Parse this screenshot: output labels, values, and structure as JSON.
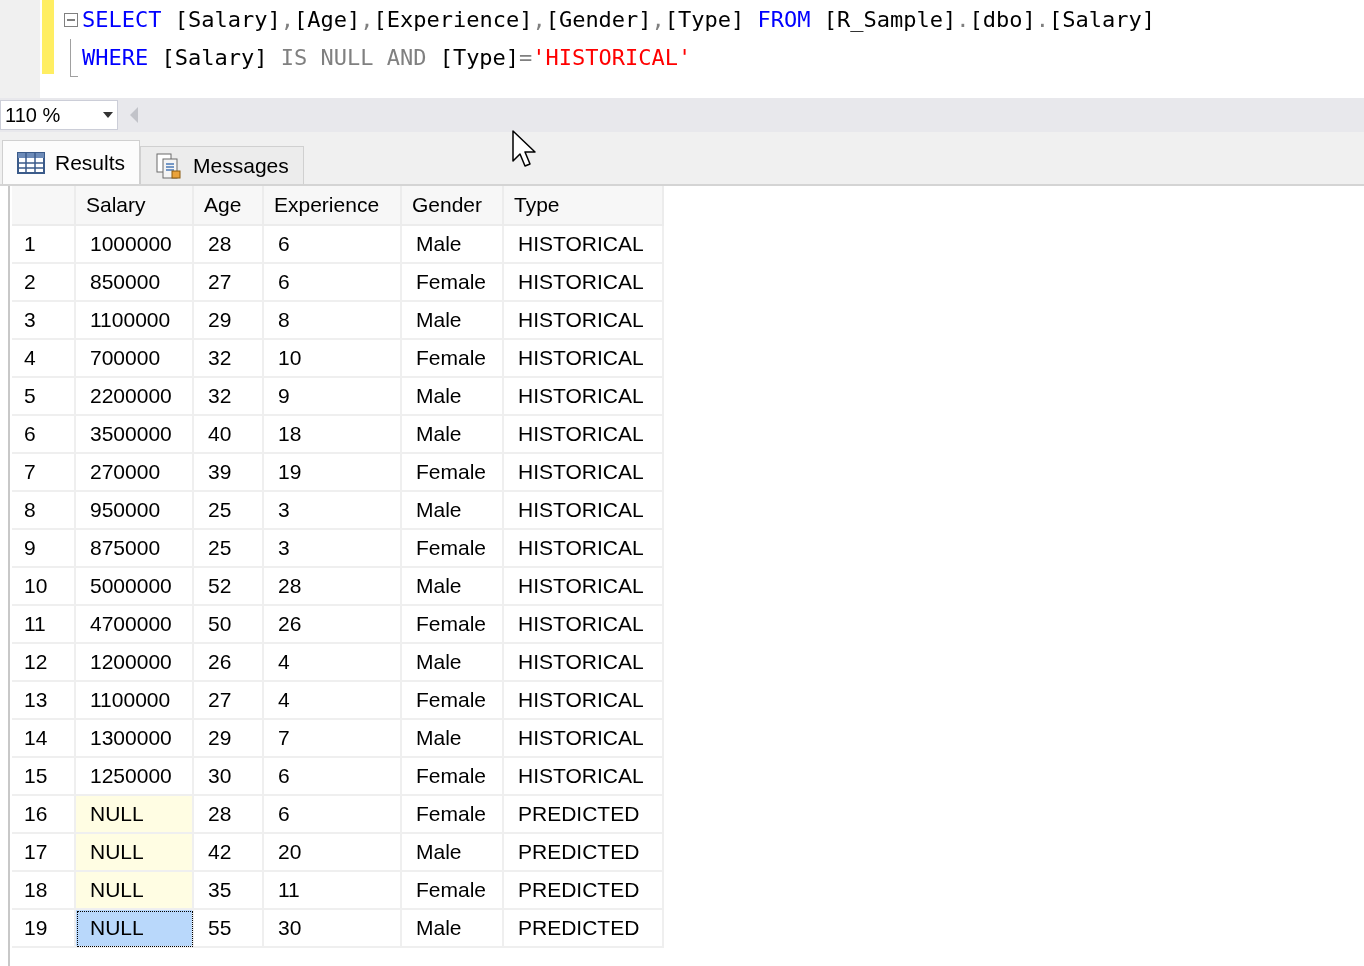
{
  "editor": {
    "lines": [
      {
        "collapsible": true,
        "tokens": [
          {
            "kind": "keyword",
            "text": "SELECT"
          },
          {
            "kind": "plain",
            "text": " [Salary]"
          },
          {
            "kind": "gray",
            "text": ","
          },
          {
            "kind": "plain",
            "text": "[Age]"
          },
          {
            "kind": "gray",
            "text": ","
          },
          {
            "kind": "plain",
            "text": "[Experience]"
          },
          {
            "kind": "gray",
            "text": ","
          },
          {
            "kind": "plain",
            "text": "[Gender]"
          },
          {
            "kind": "gray",
            "text": ","
          },
          {
            "kind": "plain",
            "text": "[Type] "
          },
          {
            "kind": "keyword",
            "text": "FROM"
          },
          {
            "kind": "plain",
            "text": " [R_Sample]"
          },
          {
            "kind": "gray",
            "text": "."
          },
          {
            "kind": "plain",
            "text": "[dbo]"
          },
          {
            "kind": "gray",
            "text": "."
          },
          {
            "kind": "plain",
            "text": "[Salary]"
          }
        ]
      },
      {
        "collapsible": false,
        "tokens": [
          {
            "kind": "keyword",
            "text": "WHERE"
          },
          {
            "kind": "plain",
            "text": " [Salary] "
          },
          {
            "kind": "gray",
            "text": "IS NULL AND"
          },
          {
            "kind": "plain",
            "text": " [Type]"
          },
          {
            "kind": "gray",
            "text": "="
          },
          {
            "kind": "string",
            "text": "'HISTORICAL'"
          }
        ]
      }
    ]
  },
  "zoom": {
    "value": "110 %"
  },
  "tabs": [
    {
      "label": "Results",
      "kind": "grid",
      "selected": true
    },
    {
      "label": "Messages",
      "kind": "messages",
      "selected": false
    }
  ],
  "table": {
    "columns": [
      "Salary",
      "Age",
      "Experience",
      "Gender",
      "Type"
    ],
    "rows": [
      {
        "number": "1",
        "salary": "1000000",
        "salary_is_null": false,
        "salary_selected": false,
        "age": "28",
        "experience": "6",
        "gender": "Male",
        "type": "HISTORICAL"
      },
      {
        "number": "2",
        "salary": "850000",
        "salary_is_null": false,
        "salary_selected": false,
        "age": "27",
        "experience": "6",
        "gender": "Female",
        "type": "HISTORICAL"
      },
      {
        "number": "3",
        "salary": "1100000",
        "salary_is_null": false,
        "salary_selected": false,
        "age": "29",
        "experience": "8",
        "gender": "Male",
        "type": "HISTORICAL"
      },
      {
        "number": "4",
        "salary": "700000",
        "salary_is_null": false,
        "salary_selected": false,
        "age": "32",
        "experience": "10",
        "gender": "Female",
        "type": "HISTORICAL"
      },
      {
        "number": "5",
        "salary": "2200000",
        "salary_is_null": false,
        "salary_selected": false,
        "age": "32",
        "experience": "9",
        "gender": "Male",
        "type": "HISTORICAL"
      },
      {
        "number": "6",
        "salary": "3500000",
        "salary_is_null": false,
        "salary_selected": false,
        "age": "40",
        "experience": "18",
        "gender": "Male",
        "type": "HISTORICAL"
      },
      {
        "number": "7",
        "salary": "270000",
        "salary_is_null": false,
        "salary_selected": false,
        "age": "39",
        "experience": "19",
        "gender": "Female",
        "type": "HISTORICAL"
      },
      {
        "number": "8",
        "salary": "950000",
        "salary_is_null": false,
        "salary_selected": false,
        "age": "25",
        "experience": "3",
        "gender": "Male",
        "type": "HISTORICAL"
      },
      {
        "number": "9",
        "salary": "875000",
        "salary_is_null": false,
        "salary_selected": false,
        "age": "25",
        "experience": "3",
        "gender": "Female",
        "type": "HISTORICAL"
      },
      {
        "number": "10",
        "salary": "5000000",
        "salary_is_null": false,
        "salary_selected": false,
        "age": "52",
        "experience": "28",
        "gender": "Male",
        "type": "HISTORICAL"
      },
      {
        "number": "11",
        "salary": "4700000",
        "salary_is_null": false,
        "salary_selected": false,
        "age": "50",
        "experience": "26",
        "gender": "Female",
        "type": "HISTORICAL"
      },
      {
        "number": "12",
        "salary": "1200000",
        "salary_is_null": false,
        "salary_selected": false,
        "age": "26",
        "experience": "4",
        "gender": "Male",
        "type": "HISTORICAL"
      },
      {
        "number": "13",
        "salary": "1100000",
        "salary_is_null": false,
        "salary_selected": false,
        "age": "27",
        "experience": "4",
        "gender": "Female",
        "type": "HISTORICAL"
      },
      {
        "number": "14",
        "salary": "1300000",
        "salary_is_null": false,
        "salary_selected": false,
        "age": "29",
        "experience": "7",
        "gender": "Male",
        "type": "HISTORICAL"
      },
      {
        "number": "15",
        "salary": "1250000",
        "salary_is_null": false,
        "salary_selected": false,
        "age": "30",
        "experience": "6",
        "gender": "Female",
        "type": "HISTORICAL"
      },
      {
        "number": "16",
        "salary": "NULL",
        "salary_is_null": true,
        "salary_selected": false,
        "age": "28",
        "experience": "6",
        "gender": "Female",
        "type": "PREDICTED"
      },
      {
        "number": "17",
        "salary": "NULL",
        "salary_is_null": true,
        "salary_selected": false,
        "age": "42",
        "experience": "20",
        "gender": "Male",
        "type": "PREDICTED"
      },
      {
        "number": "18",
        "salary": "NULL",
        "salary_is_null": true,
        "salary_selected": false,
        "age": "35",
        "experience": "11",
        "gender": "Female",
        "type": "PREDICTED"
      },
      {
        "number": "19",
        "salary": "NULL",
        "salary_is_null": true,
        "salary_selected": true,
        "age": "55",
        "experience": "30",
        "gender": "Male",
        "type": "PREDICTED"
      }
    ]
  }
}
